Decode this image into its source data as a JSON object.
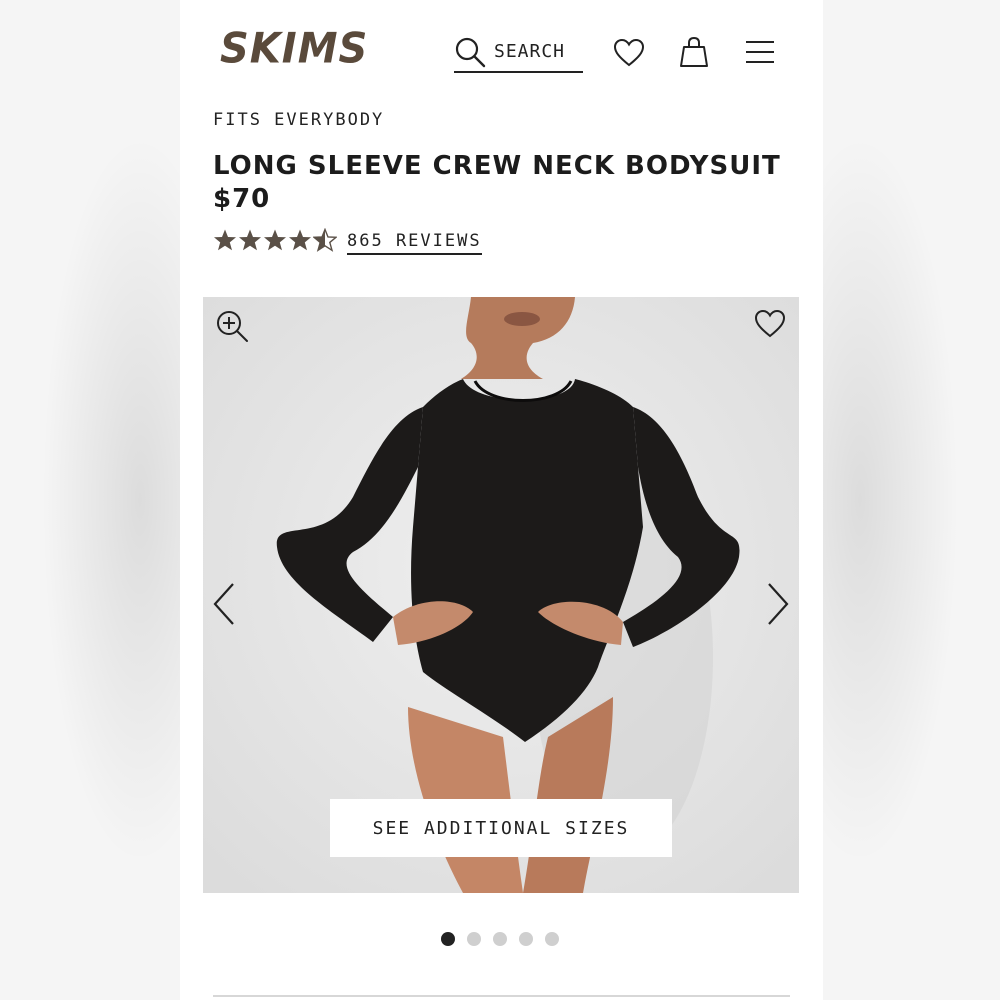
{
  "brand": {
    "logo_text": "SKIMS",
    "logo_color": "#5a4a3b"
  },
  "header": {
    "search_label": "SEARCH",
    "icons": [
      "search-icon",
      "heart-icon",
      "shopping-bag-icon",
      "hamburger-menu-icon"
    ]
  },
  "product": {
    "collection": "FITS EVERYBODY",
    "title": "LONG SLEEVE CREW NECK BODYSUIT",
    "price": "$70",
    "rating": 4.5,
    "rating_max": 5,
    "reviews_label": "865 REVIEWS"
  },
  "gallery": {
    "see_sizes_label": "SEE ADDITIONAL SIZES",
    "image_count": 5,
    "active_index": 0,
    "icons": [
      "zoom-in-icon",
      "heart-icon",
      "chevron-left-icon",
      "chevron-right-icon"
    ]
  },
  "colors": {
    "text": "#1c1c1c",
    "star": "#5a5047",
    "background": "#ffffff",
    "image_bg": "#e6e6e6"
  }
}
